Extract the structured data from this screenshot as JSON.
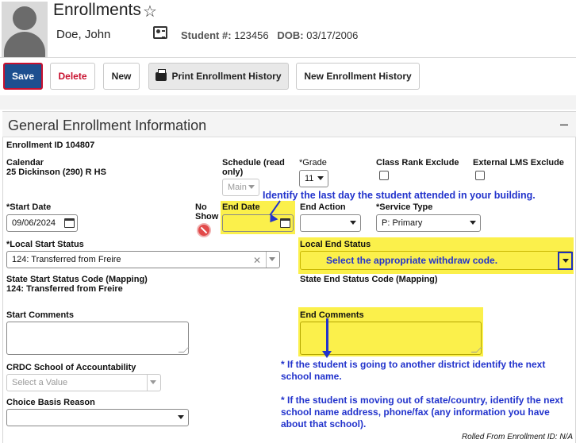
{
  "header": {
    "title": "Enrollments",
    "student_name": "Doe, John",
    "student_num_label": "Student #:",
    "student_num": "123456",
    "dob_label": "DOB:",
    "dob": "03/17/2006"
  },
  "toolbar": {
    "save": "Save",
    "delete": "Delete",
    "new": "New",
    "print_history": "Print Enrollment History",
    "new_history": "New Enrollment History"
  },
  "section": {
    "title": "General Enrollment Information",
    "collapse": "–"
  },
  "enrollment": {
    "id_label": "Enrollment ID 104807",
    "calendar_label": "Calendar",
    "calendar_value": "25 Dickinson (290) R HS",
    "schedule_label": "Schedule (read only)",
    "schedule_value": "Main",
    "grade_label": "*Grade",
    "grade_value": "11",
    "class_rank_label": "Class Rank Exclude",
    "external_lms_label": "External LMS Exclude",
    "start_date_label": "*Start Date",
    "start_date_value": "09/06/2024",
    "no_show_label": "No Show",
    "end_date_label": "End Date",
    "end_date_value": "",
    "end_action_label": "End Action",
    "end_action_value": "",
    "service_type_label": "*Service Type",
    "service_type_value": "P: Primary",
    "local_start_label": "*Local Start Status",
    "local_start_value": "124: Transferred from Freire",
    "local_end_label": "Local End Status",
    "state_start_label": "State Start Status Code (Mapping)",
    "state_start_value": "124: Transferred from Freire",
    "state_end_label": "State End Status Code (Mapping)",
    "start_comments_label": "Start Comments",
    "end_comments_label": "End Comments",
    "crdc_label": "CRDC School of Accountability",
    "crdc_placeholder": "Select a Value",
    "choice_label": "Choice Basis Reason",
    "rolled_from": "Rolled From Enrollment ID: N/A"
  },
  "annotations": {
    "end_date_note": "Identify the last day the student attended in your building.",
    "end_status_note": "Select the appropriate withdraw code.",
    "comment_note_1": "* If the student is going to another district identify the next school name.",
    "comment_note_2": "* If the student is moving out of state/country, identify the next school name address, phone/fax (any information you have about that school)."
  },
  "colors": {
    "save_bg": "#1d4f8f",
    "required_red": "#d40000",
    "highlight_yellow": "#fbf04b",
    "annotation_blue": "#2233cc"
  }
}
